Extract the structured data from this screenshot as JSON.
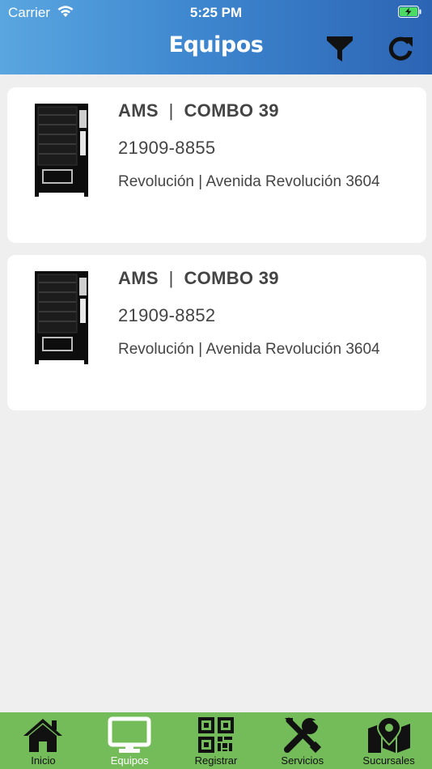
{
  "status_bar": {
    "carrier": "Carrier",
    "time": "5:25 PM"
  },
  "header": {
    "title": "Equipos",
    "filter_icon": "filter-icon",
    "refresh_icon": "refresh-icon",
    "gradient": [
      "#5aa6e0",
      "#2c64b4"
    ]
  },
  "equipos": [
    {
      "brand": "AMS",
      "model": "COMBO 39",
      "serial": "21909-8855",
      "location": "Revolución | Avenida Revolución 3604"
    },
    {
      "brand": "AMS",
      "model": "COMBO 39",
      "serial": "21909-8852",
      "location": "Revolución | Avenida Revolución 3604"
    }
  ],
  "tabbar": {
    "color": "#74bb5a",
    "active_index": 1,
    "tabs": [
      {
        "label": "Inicio",
        "icon": "home-icon"
      },
      {
        "label": "Equipos",
        "icon": "monitor-icon"
      },
      {
        "label": "Registrar",
        "icon": "qr-code-icon"
      },
      {
        "label": "Servicios",
        "icon": "tools-icon"
      },
      {
        "label": "Sucursales",
        "icon": "map-pin-icon"
      }
    ]
  }
}
